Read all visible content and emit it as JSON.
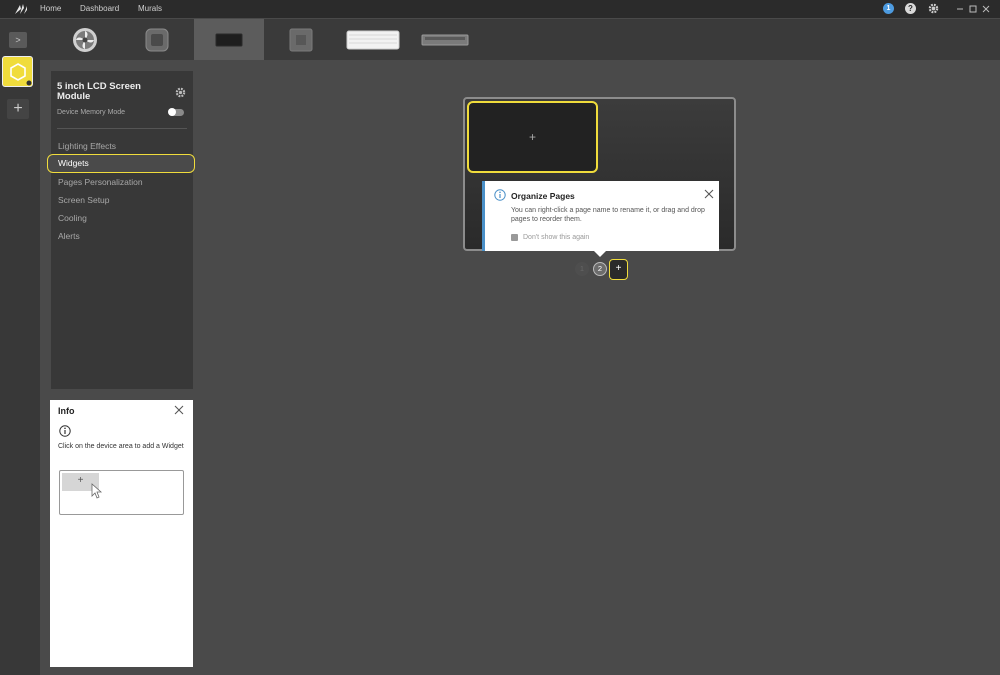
{
  "topbar": {
    "nav": [
      "Home",
      "Dashboard",
      "Murals"
    ],
    "notification_count": "1",
    "help_label": "?"
  },
  "devices": [
    {
      "name": "fan-device",
      "selected": false
    },
    {
      "name": "cooler-device",
      "selected": false
    },
    {
      "name": "lcd-screen-device",
      "selected": true
    },
    {
      "name": "pump-device",
      "selected": false
    },
    {
      "name": "keyboard-device",
      "selected": false
    },
    {
      "name": "memory-device",
      "selected": false
    }
  ],
  "rail": {
    "expand_label": ">",
    "add_label": "+"
  },
  "panel": {
    "title": "5 inch LCD Screen Module",
    "memory_mode_label": "Device Memory Mode",
    "menu": [
      "Lighting Effects",
      "Widgets",
      "Pages Personalization",
      "Screen Setup",
      "Cooling",
      "Alerts"
    ],
    "active_menu": "Widgets"
  },
  "info": {
    "title": "Info",
    "text": "Click on the device area to add a Widget",
    "demo_plus": "+"
  },
  "screen": {
    "plus": "+"
  },
  "tooltip": {
    "title": "Organize Pages",
    "text": "You can right-click a page name to rename it, or drag and drop pages to reorder them.",
    "checkbox_label": "Don't show this again"
  },
  "pages": {
    "items": [
      "1",
      "2"
    ],
    "add_label": "+"
  },
  "colors": {
    "accent": "#f0dc3c",
    "info_blue": "#4a90c8",
    "background": "#4a4a4a"
  }
}
